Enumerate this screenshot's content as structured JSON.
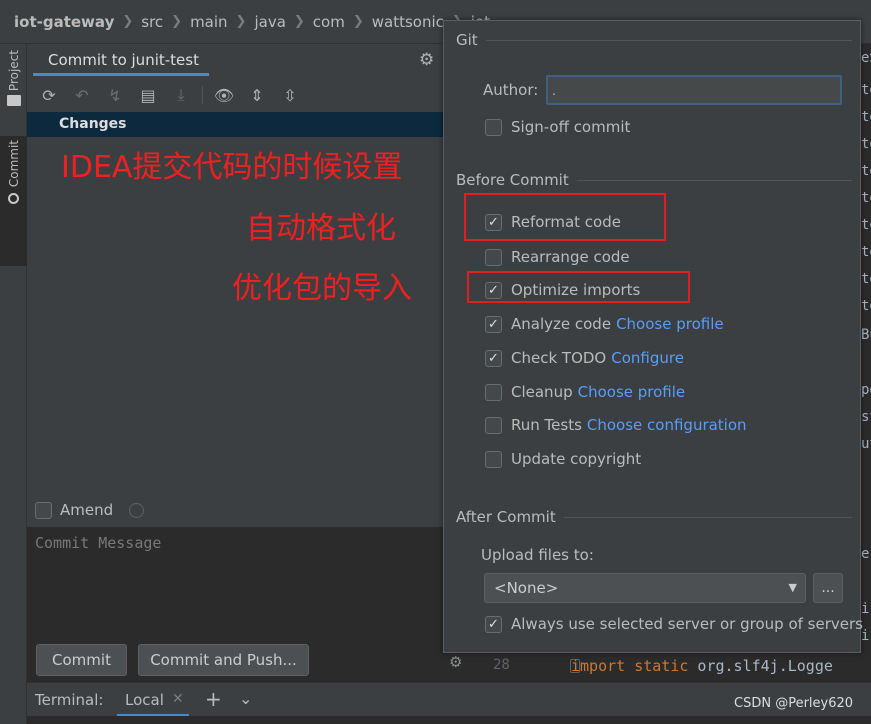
{
  "breadcrumb": [
    "iot-gateway",
    "src",
    "main",
    "java",
    "com",
    "wattsonic",
    "iot"
  ],
  "sidebar": {
    "project": "Project",
    "commit": "Commit"
  },
  "panel": {
    "title": "Commit to junit-test",
    "changes": "Changes",
    "amend": "Amend",
    "message_placeholder": "Commit Message",
    "commit_button": "Commit",
    "commit_push_button": "Commit and Push..."
  },
  "annotations": [
    "IDEA提交代码的时候设置",
    "自动格式化",
    "优化包的导入"
  ],
  "popup": {
    "git_section": "Git",
    "author_label": "Author:",
    "author_value": ".",
    "signoff": "Sign-off commit",
    "before_section": "Before Commit",
    "options": [
      {
        "label": "Reformat code",
        "checked": true,
        "link": ""
      },
      {
        "label": "Rearrange code",
        "checked": false,
        "link": ""
      },
      {
        "label": "Optimize imports",
        "checked": true,
        "link": ""
      },
      {
        "label": "Analyze code",
        "checked": true,
        "link": "Choose profile"
      },
      {
        "label": "Check TODO",
        "checked": true,
        "link": "Configure"
      },
      {
        "label": "Cleanup",
        "checked": false,
        "link": "Choose profile"
      },
      {
        "label": "Run Tests",
        "checked": false,
        "link": "Choose configuration"
      },
      {
        "label": "Update copyright",
        "checked": false,
        "link": ""
      }
    ],
    "after_section": "After Commit",
    "upload_label": "Upload files to:",
    "upload_value": "<None>",
    "dots_button": "...",
    "always_use": "Always use selected server or group of servers"
  },
  "editor": {
    "fragments": [
      "eS",
      "te",
      "te",
      "te",
      "te",
      "te",
      "te",
      "te",
      "te",
      "te",
      "Bu",
      "pe",
      "st",
      "ut",
      "er",
      "i",
      "i",
      "i"
    ],
    "line_number": "28",
    "code_keyword": "import static",
    "code_rest": " org.slf4j.Logge"
  },
  "terminal": {
    "label": "Terminal:",
    "tab": "Local"
  },
  "watermark": "CSDN @Perley620",
  "colors": {
    "accent": "#4a88c7",
    "link": "#589df6",
    "annotation": "#f02020",
    "selection": "#0d293e"
  }
}
